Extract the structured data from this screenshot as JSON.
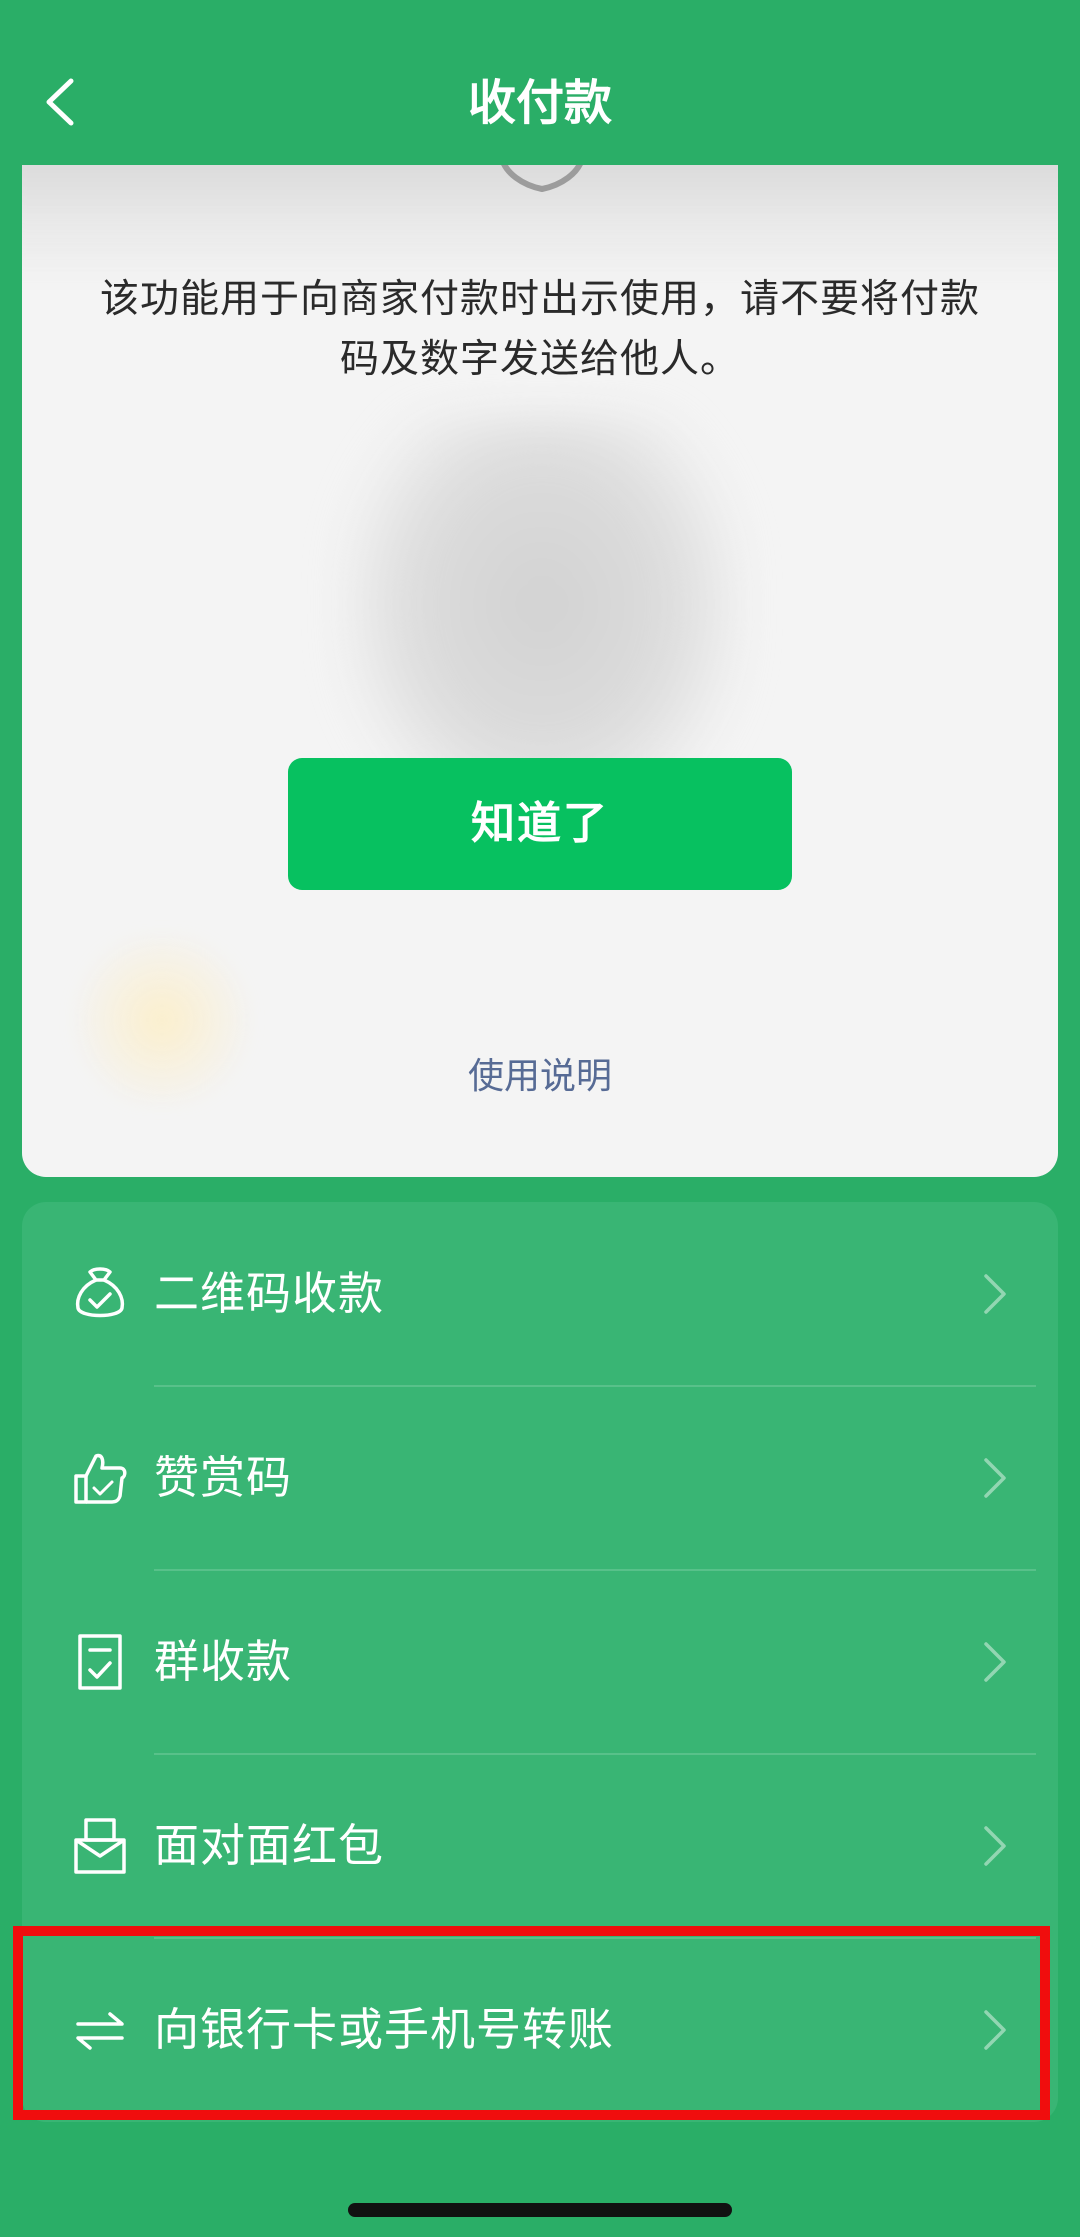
{
  "header": {
    "title": "收付款"
  },
  "notice_card": {
    "message": "该功能用于向商家付款时出示使用，请不要将付款码及数字发送给他人。",
    "confirm_button": "知道了",
    "help_link": "使用说明"
  },
  "menu": {
    "items": [
      {
        "label": "二维码收款",
        "icon": "money-bag-icon"
      },
      {
        "label": "赞赏码",
        "icon": "thumbs-up-icon"
      },
      {
        "label": "群收款",
        "icon": "receipt-icon"
      },
      {
        "label": "面对面红包",
        "icon": "red-packet-icon"
      },
      {
        "label": "向银行卡或手机号转账",
        "icon": "transfer-arrows-icon"
      }
    ]
  },
  "colors": {
    "background": "#2aae67",
    "panel": "#39b574",
    "primary_button": "#07c160",
    "link": "#576b95",
    "highlight": "#f00d0d"
  }
}
